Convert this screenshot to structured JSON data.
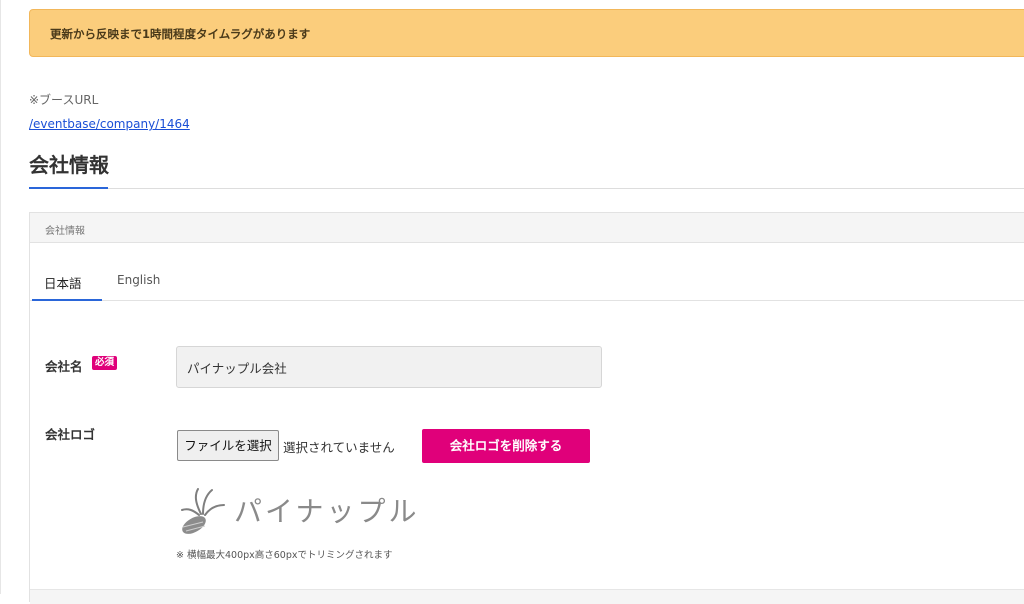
{
  "notice": {
    "text": "更新から反映まで1時間程度タイムラグがあります",
    "bg_color": "#fbcd7c"
  },
  "booth": {
    "label": "※ブースURL",
    "url_text": "/eventbase/company/1464"
  },
  "page": {
    "title": "会社情報"
  },
  "card": {
    "header": "会社情報",
    "tabs": [
      {
        "label": "日本語",
        "active": true
      },
      {
        "label": "English",
        "active": false
      }
    ]
  },
  "form": {
    "company_name": {
      "label": "会社名",
      "required_badge": "必須",
      "value": "パイナップル会社"
    },
    "company_logo": {
      "label": "会社ロゴ",
      "file_button": "ファイルを選択",
      "file_status": "選択されていません",
      "delete_button": "会社ロゴを削除する",
      "logo_image_text": "パイナップル",
      "note": "※ 横幅最大400px高さ60pxでトリミングされます"
    }
  },
  "colors": {
    "accent_blue": "#2a66d9",
    "brand_pink": "#e0007a",
    "link_blue": "#1a4fd6"
  },
  "icons": [
    "pineapple-icon"
  ]
}
